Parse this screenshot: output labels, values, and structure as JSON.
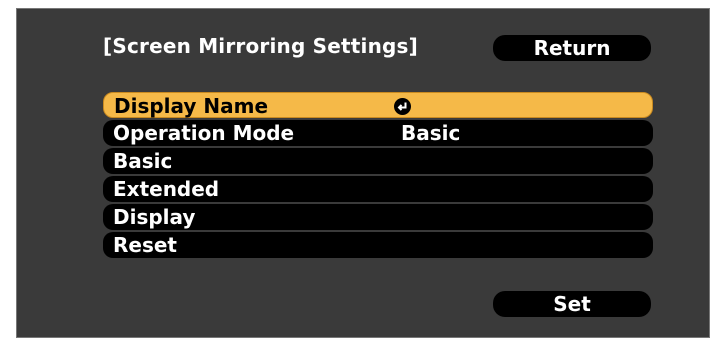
{
  "window": {
    "title": "[Screen Mirroring Settings]"
  },
  "buttons": {
    "return_label": "Return",
    "set_label": "Set"
  },
  "menu": {
    "items": [
      {
        "label": "Display Name",
        "value": "",
        "icon": "enter-icon",
        "selected": true
      },
      {
        "label": "Operation Mode",
        "value": "Basic"
      },
      {
        "label": "Basic",
        "value": ""
      },
      {
        "label": "Extended",
        "value": ""
      },
      {
        "label": "Display",
        "value": ""
      },
      {
        "label": "Reset",
        "value": ""
      }
    ]
  },
  "colors": {
    "background": "#3a3a3a",
    "item_background": "#000000",
    "selected_highlight": "#f5b948",
    "text": "#ffffff"
  }
}
